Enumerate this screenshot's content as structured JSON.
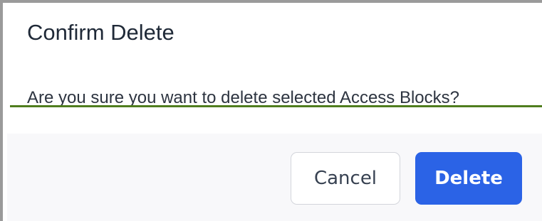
{
  "dialog": {
    "title": "Confirm Delete",
    "message": "Are you sure you want to delete selected Access Blocks?",
    "cancel_label": "Cancel",
    "delete_label": "Delete"
  },
  "colors": {
    "primary": "#2b63e6",
    "highlight_line": "#4f7d1e",
    "footer_background": "#f8f8fa"
  }
}
